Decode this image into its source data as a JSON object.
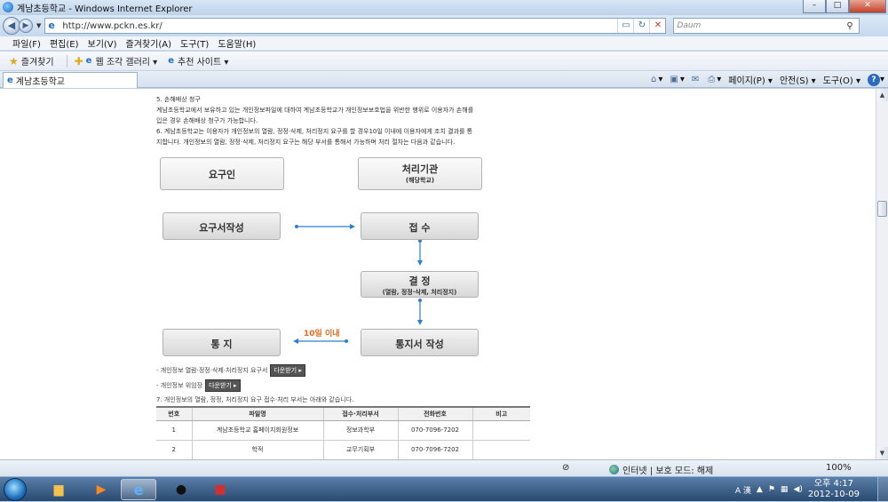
{
  "window": {
    "title": "계남초등학교 - Windows Internet Explorer",
    "min_label": "–",
    "max_label": "□",
    "close_label": "✕"
  },
  "address": {
    "url": "http://www.pckn.es.kr/",
    "search_placeholder": "Daum"
  },
  "menubar": {
    "items": [
      "파일(F)",
      "편집(E)",
      "보기(V)",
      "즐겨찾기(A)",
      "도구(T)",
      "도움말(H)"
    ]
  },
  "favorites": {
    "label": "즐겨찾기",
    "items": [
      "웹 조각 갤러리 ▾",
      "추천 사이트 ▾"
    ]
  },
  "tab": {
    "title": "계남초등학교"
  },
  "commands": {
    "page": "페이지(P) ▾",
    "safety": "안전(S) ▾",
    "tools": "도구(O) ▾"
  },
  "content": {
    "lines": [
      "5. 손해배상 청구",
      "계남초등학교에서 보유하고 있는 개인정보파일에 대하여 계남초등학교가 개인정보보호법을 위반한 행위로 이용자가 손해를",
      "입은 경우 손해배상 청구가 가능합니다.",
      "6. 계남초등학교는 이용자가 개인정보의 열람, 정정·삭제, 처리정지 요구를 할 경우10일 이내에 이용자에게 조치 결과를 통",
      "지합니다. 개인정보의 열람, 정정·삭제, 처리정지 요구는 해당 부서를 통해서 가능하며 처리 절차는 다음과 같습니다."
    ],
    "flow": {
      "requester": "요구인",
      "processor": "처리기관",
      "processor_sub": "(해당학교)",
      "write_request": "요구서작성",
      "receive": "접 수",
      "decide": "결 정",
      "decide_sub": "(열람, 정정·삭제, 처리정지)",
      "notify": "통 지",
      "write_notice": "통지서 작성",
      "within_10": "10일 이내"
    },
    "download1_text": "- 개인정보 열람·정정·삭제·처리정지 요구서",
    "download2_text": "- 개인정보 위임장",
    "download_label": "다운받기 ▸",
    "section7": "7. 개인정보의 열람, 정정, 처리정지 요구 접수·처리 부서는 아래와 같습니다."
  },
  "table": {
    "headers": [
      "번호",
      "파일명",
      "접수·처리부서",
      "전화번호",
      "비고"
    ],
    "rows": [
      [
        "1",
        "계남초등학교 홈페이지회원정보",
        "정보과학부",
        "070-7096-7202",
        ""
      ],
      [
        "2",
        "학적",
        "교무기획부",
        "070-7096-7202",
        ""
      ]
    ]
  },
  "statusbar": {
    "zone": "인터넷 | 보호 모드: 해제",
    "zoom": "100%"
  },
  "taskbar": {
    "time": "오후 4:17",
    "date": "2012-10-09",
    "ime": "A 漢"
  }
}
